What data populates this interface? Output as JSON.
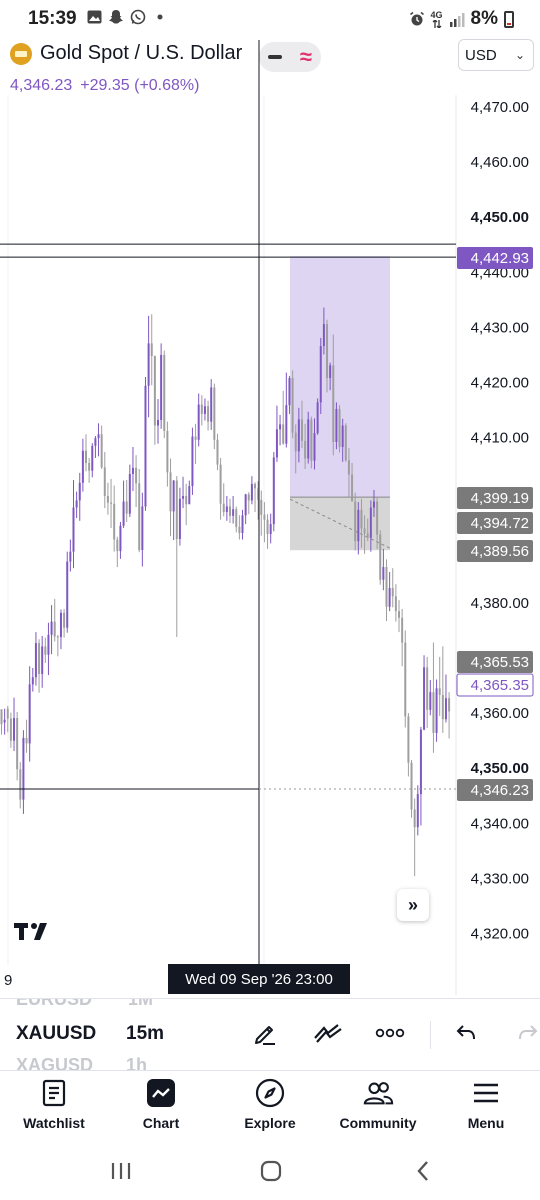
{
  "status_bar": {
    "time": "15:39",
    "network": "4G",
    "battery": "8%",
    "icons_left": [
      "gallery-icon",
      "snapchat-icon",
      "whatsapp-icon",
      "dot-icon"
    ],
    "icons_right": [
      "alarm-icon",
      "network-4g-icon",
      "signal-icon",
      "battery-icon"
    ]
  },
  "header": {
    "symbol_title": "Gold Spot / U.S. Dollar",
    "currency": "USD",
    "last_price": "4,346.23",
    "change": "+29.35 (+0.68%)",
    "accent_color": "#7e57c2",
    "indicator_color": "#e0306e"
  },
  "chart_data": {
    "type": "candlestick",
    "title": "Gold Spot / U.S. Dollar",
    "xlabel": "",
    "ylabel": "",
    "ylim": [
      4314,
      4476
    ],
    "y_ticks": [
      "4,470.00",
      "4,460.00",
      "4,450.00",
      "4,440.00",
      "4,430.00",
      "4,420.00",
      "4,410.00",
      "4,380.00",
      "4,360.00",
      "4,350.00",
      "4,340.00",
      "4,330.00",
      "4,320.00"
    ],
    "y_tick_values": [
      4470,
      4460,
      4450,
      4440,
      4430,
      4420,
      4410,
      4380,
      4360,
      4350,
      4340,
      4330,
      4320
    ],
    "bold_ticks": [
      4450,
      4350
    ],
    "price_labels": [
      {
        "text": "4,442.93",
        "value": 4442.93,
        "style": "purple"
      },
      {
        "text": "4,399.19",
        "value": 4399.19,
        "style": "gray"
      },
      {
        "text": "4,394.72",
        "value": 4394.72,
        "style": "gray"
      },
      {
        "text": "4,389.56",
        "value": 4389.56,
        "style": "gray"
      },
      {
        "text": "4,365.53",
        "value": 4365.53,
        "style": "gray"
      },
      {
        "text": "4,365.35",
        "value": 4365.35,
        "style": "outline"
      },
      {
        "text": "4,346.23",
        "value": 4346.23,
        "style": "gray"
      }
    ],
    "position_tool": {
      "target": 4442.93,
      "entry": 4399.19,
      "stop": 4389.56,
      "target_color": "#d9d0f0",
      "stop_color": "#d6d6d6"
    },
    "crosshair_price": 4346.23,
    "horizontal_line_price": 4442.93,
    "x_axis_label": "9",
    "crosshair_time": "Wed 09 Sep '26   23:00",
    "up_color": "#7e57c2",
    "down_color": "#9e9e9e",
    "candles": [
      [
        4360.7,
        4358.0,
        4358.3,
        4356.1
      ],
      [
        4358.3,
        4358.8,
        4360.8,
        4356.1
      ],
      [
        4360.8,
        4359.0,
        4361.3,
        4356.5
      ],
      [
        4359.0,
        4355.0,
        4360.1,
        4353.7
      ],
      [
        4355.0,
        4359.1,
        4362.8,
        4353.1
      ],
      [
        4359.1,
        4349.8,
        4360.2,
        4347.8
      ],
      [
        4349.8,
        4344.3,
        4351.1,
        4342.7
      ],
      [
        4344.3,
        4355.5,
        4356.9,
        4341.7
      ],
      [
        4355.5,
        4354.5,
        4358.8,
        4352.8
      ],
      [
        4354.5,
        4365.2,
        4368.5,
        4351.2
      ],
      [
        4365.2,
        4366.5,
        4368.2,
        4363.9
      ],
      [
        4366.5,
        4372.7,
        4374.7,
        4365.0
      ],
      [
        4372.7,
        4367.1,
        4373.4,
        4363.7
      ],
      [
        4367.1,
        4372.1,
        4374.0,
        4364.6
      ],
      [
        4372.1,
        4370.6,
        4373.7,
        4369.1
      ],
      [
        4370.6,
        4374.2,
        4376.4,
        4366.9
      ],
      [
        4374.2,
        4376.6,
        4379.6,
        4370.7
      ],
      [
        4376.6,
        4373.9,
        4380.7,
        4373.0
      ],
      [
        4373.9,
        4373.8,
        4374.2,
        4370.3
      ],
      [
        4373.8,
        4378.2,
        4378.8,
        4371.6
      ],
      [
        4378.2,
        4375.5,
        4378.9,
        4373.7
      ],
      [
        4375.5,
        4387.5,
        4389.3,
        4374.6
      ],
      [
        4387.5,
        4389.3,
        4391.5,
        4385.7
      ],
      [
        4389.3,
        4397.3,
        4402.3,
        4386.3
      ],
      [
        4397.3,
        4398.6,
        4400.2,
        4395.4
      ],
      [
        4398.6,
        4401.8,
        4403.6,
        4394.9
      ],
      [
        4401.8,
        4407.6,
        4409.8,
        4400.2
      ],
      [
        4407.6,
        4405.4,
        4410.6,
        4403.9
      ],
      [
        4405.4,
        4404.0,
        4406.3,
        4401.8
      ],
      [
        4404.0,
        4408.5,
        4409.0,
        4402.8
      ],
      [
        4408.5,
        4409.9,
        4410.3,
        4406.3
      ],
      [
        4409.9,
        4410.6,
        4412.6,
        4406.6
      ],
      [
        4410.6,
        4404.6,
        4412.2,
        4404.3
      ],
      [
        4404.6,
        4399.4,
        4407.4,
        4397.2
      ],
      [
        4399.4,
        4398.2,
        4401.8,
        4396.0
      ],
      [
        4398.2,
        4398.0,
        4402.5,
        4393.6
      ],
      [
        4398.0,
        4391.5,
        4401.3,
        4389.3
      ],
      [
        4391.5,
        4389.4,
        4392.0,
        4386.5
      ],
      [
        4389.4,
        4394.0,
        4394.7,
        4388.0
      ],
      [
        4394.0,
        4398.4,
        4402.2,
        4393.6
      ],
      [
        4398.4,
        4396.2,
        4402.3,
        4394.7
      ],
      [
        4396.2,
        4403.4,
        4405.1,
        4395.6
      ],
      [
        4403.4,
        4404.5,
        4408.3,
        4400.3
      ],
      [
        4404.5,
        4401.7,
        4406.8,
        4397.4
      ],
      [
        4401.7,
        4389.6,
        4404.3,
        4389.2
      ],
      [
        4389.6,
        4397.5,
        4400.0,
        4386.6
      ],
      [
        4397.5,
        4419.4,
        4421.0,
        4396.7
      ],
      [
        4419.4,
        4427.1,
        4432.1,
        4413.7
      ],
      [
        4427.1,
        4424.8,
        4432.4,
        4419.5
      ],
      [
        4424.8,
        4412.2,
        4424.9,
        4408.7
      ],
      [
        4412.2,
        4413.2,
        4417.0,
        4408.9
      ],
      [
        4413.2,
        4425.0,
        4427.1,
        4411.6
      ],
      [
        4425.0,
        4411.2,
        4425.8,
        4409.9
      ],
      [
        4411.2,
        4403.7,
        4412.9,
        4401.1
      ],
      [
        4403.7,
        4396.6,
        4406.2,
        4392.1
      ],
      [
        4396.6,
        4402.2,
        4402.3,
        4391.4
      ],
      [
        4402.2,
        4391.6,
        4403.0,
        4373.8
      ],
      [
        4391.6,
        4398.9,
        4400.9,
        4390.4
      ],
      [
        4398.9,
        4399.4,
        4402.9,
        4397.2
      ],
      [
        4399.4,
        4397.9,
        4401.6,
        4394.1
      ],
      [
        4397.9,
        4401.2,
        4402.2,
        4398.5
      ],
      [
        4401.2,
        4410.2,
        4411.8,
        4399.6
      ],
      [
        4410.2,
        4409.6,
        4412.5,
        4405.2
      ],
      [
        4409.6,
        4416.0,
        4418.0,
        4408.4
      ],
      [
        4416.0,
        4414.3,
        4417.7,
        4412.2
      ],
      [
        4414.3,
        4415.7,
        4417.1,
        4413.1
      ],
      [
        4415.7,
        4412.9,
        4416.7,
        4411.3
      ],
      [
        4412.9,
        4419.1,
        4420.6,
        4411.4
      ],
      [
        4419.1,
        4409.6,
        4419.8,
        4407.9
      ],
      [
        4409.6,
        4405.1,
        4410.7,
        4404.1
      ],
      [
        4405.1,
        4398.0,
        4406.3,
        4395.1
      ],
      [
        4398.0,
        4396.5,
        4401.7,
        4395.7
      ],
      [
        4396.5,
        4397.5,
        4399.4,
        4394.9
      ],
      [
        4397.5,
        4395.8,
        4398.9,
        4394.5
      ],
      [
        4395.8,
        4397.0,
        4399.4,
        4394.4
      ],
      [
        4397.0,
        4393.8,
        4397.5,
        4392.8
      ],
      [
        4393.8,
        4392.7,
        4395.9,
        4391.5
      ],
      [
        4392.7,
        4395.9,
        4396.9,
        4391.5
      ],
      [
        4395.9,
        4399.7,
        4399.8,
        4394.3
      ],
      [
        4399.7,
        4398.6,
        4400.1,
        4396.1
      ],
      [
        4398.6,
        4401.6,
        4403.0,
        4397.9
      ],
      [
        4401.6,
        4400.8,
        4401.9,
        4396.5
      ],
      [
        4400.8,
        4398.7,
        4402.1,
        4395.1
      ],
      [
        4398.7,
        4396.0,
        4400.4,
        4392.2
      ],
      [
        4396.0,
        4395.1,
        4398.3,
        4391.0
      ],
      [
        4395.1,
        4392.5,
        4396.1,
        4389.8
      ],
      [
        4392.5,
        4394.3,
        4396.2,
        4390.8
      ],
      [
        4394.3,
        4406.4,
        4407.4,
        4393.0
      ],
      [
        4406.4,
        4411.5,
        4415.8,
        4405.6
      ],
      [
        4411.5,
        4412.4,
        4414.1,
        4408.6
      ],
      [
        4412.4,
        4408.9,
        4418.5,
        4408.7
      ],
      [
        4408.9,
        4415.9,
        4421.8,
        4408.2
      ],
      [
        4415.9,
        4420.8,
        4421.2,
        4414.3
      ],
      [
        4420.8,
        4410.9,
        4422.2,
        4409.9
      ],
      [
        4410.9,
        4407.5,
        4412.4,
        4403.5
      ],
      [
        4407.5,
        4413.3,
        4415.4,
        4405.5
      ],
      [
        4413.3,
        4409.4,
        4416.7,
        4408.1
      ],
      [
        4409.4,
        4406.2,
        4412.5,
        4404.3
      ],
      [
        4406.2,
        4413.3,
        4414.7,
        4405.3
      ],
      [
        4413.3,
        4405.8,
        4413.8,
        4404.4
      ],
      [
        4405.8,
        4410.8,
        4413.5,
        4404.2
      ],
      [
        4410.8,
        4416.4,
        4417.1,
        4410.5
      ],
      [
        4416.4,
        4426.6,
        4428.1,
        4414.3
      ],
      [
        4426.6,
        4430.6,
        4433.6,
        4425.1
      ],
      [
        4430.6,
        4420.8,
        4431.4,
        4418.2
      ],
      [
        4420.8,
        4423.1,
        4423.6,
        4418.6
      ],
      [
        4423.1,
        4409.2,
        4428.7,
        4406.8
      ],
      [
        4409.2,
        4415.2,
        4416.4,
        4407.9
      ],
      [
        4415.2,
        4408.3,
        4415.9,
        4407.3
      ],
      [
        4408.3,
        4412.2,
        4413.4,
        4405.6
      ],
      [
        4412.2,
        4405.9,
        4412.6,
        4405.6
      ],
      [
        4405.9,
        4403.3,
        4408.1,
        4399.2
      ],
      [
        4403.3,
        4398.4,
        4405.4,
        4399.3
      ],
      [
        4398.4,
        4391.2,
        4400.0,
        4389.5
      ],
      [
        4391.2,
        4396.9,
        4398.3,
        4388.8
      ],
      [
        4396.9,
        4393.5,
        4398.9,
        4390.0
      ],
      [
        4393.5,
        4392.6,
        4395.9,
        4388.9
      ],
      [
        4392.6,
        4391.8,
        4395.3,
        4391.2
      ],
      [
        4391.8,
        4397.3,
        4398.6,
        4389.3
      ],
      [
        4397.3,
        4398.4,
        4400.5,
        4395.6
      ],
      [
        4398.4,
        4392.4,
        4399.2,
        4389.8
      ],
      [
        4392.4,
        4384.2,
        4393.2,
        4383.3
      ],
      [
        4384.2,
        4386.5,
        4389.8,
        4382.3
      ],
      [
        4386.5,
        4379.3,
        4387.9,
        4376.7
      ],
      [
        4379.3,
        4382.7,
        4385.6,
        4378.5
      ],
      [
        4382.7,
        4381.2,
        4386.3,
        4379.2
      ],
      [
        4381.2,
        4378.5,
        4383.4,
        4376.6
      ],
      [
        4378.5,
        4377.3,
        4380.5,
        4374.7
      ],
      [
        4377.3,
        4372.8,
        4378.9,
        4368.5
      ],
      [
        4372.8,
        4359.4,
        4375.0,
        4357.4
      ],
      [
        4359.4,
        4351.0,
        4360.0,
        4348.5
      ],
      [
        4351.0,
        4342.5,
        4351.5,
        4341.0
      ],
      [
        4342.5,
        4339.3,
        4344.5,
        4330.4
      ],
      [
        4339.3,
        4345.3,
        4346.9,
        4337.8
      ],
      [
        4345.3,
        4357.0,
        4357.5,
        4339.6
      ],
      [
        4357.0,
        4368.3,
        4370.5,
        4356.9
      ],
      [
        4368.3,
        4360.6,
        4370.2,
        4357.3
      ],
      [
        4360.6,
        4363.8,
        4366.0,
        4359.6
      ],
      [
        4363.8,
        4356.4,
        4372.8,
        4352.8
      ],
      [
        4356.4,
        4364.5,
        4366.1,
        4354.8
      ],
      [
        4364.5,
        4363.3,
        4370.2,
        4359.5
      ],
      [
        4363.3,
        4358.9,
        4372.1,
        4356.4
      ],
      [
        4358.9,
        4362.7,
        4367.0,
        4358.3
      ],
      [
        4362.7,
        4360.3,
        4363.8,
        4355.4
      ]
    ]
  },
  "chart_overlay": {
    "tv_logo": "tradingview-logo",
    "scroll_forward": "»"
  },
  "toolbar": {
    "symbol_prev": "EURUSD",
    "symbol": "XAUUSD",
    "symbol_next": "XAGUSD",
    "interval_prev": "1M",
    "interval": "15m",
    "interval_next": "1h",
    "tools": [
      "pen-icon",
      "trend-drawing-icon",
      "more-icon",
      "undo-icon",
      "redo-icon"
    ]
  },
  "bottom_nav": {
    "items": [
      {
        "label": "Watchlist",
        "icon": "watchlist-icon"
      },
      {
        "label": "Chart",
        "icon": "chart-icon"
      },
      {
        "label": "Explore",
        "icon": "compass-icon"
      },
      {
        "label": "Community",
        "icon": "community-icon"
      },
      {
        "label": "Menu",
        "icon": "menu-icon"
      }
    ]
  },
  "system_nav": {
    "buttons": [
      "recents-icon",
      "home-icon",
      "back-icon"
    ]
  }
}
